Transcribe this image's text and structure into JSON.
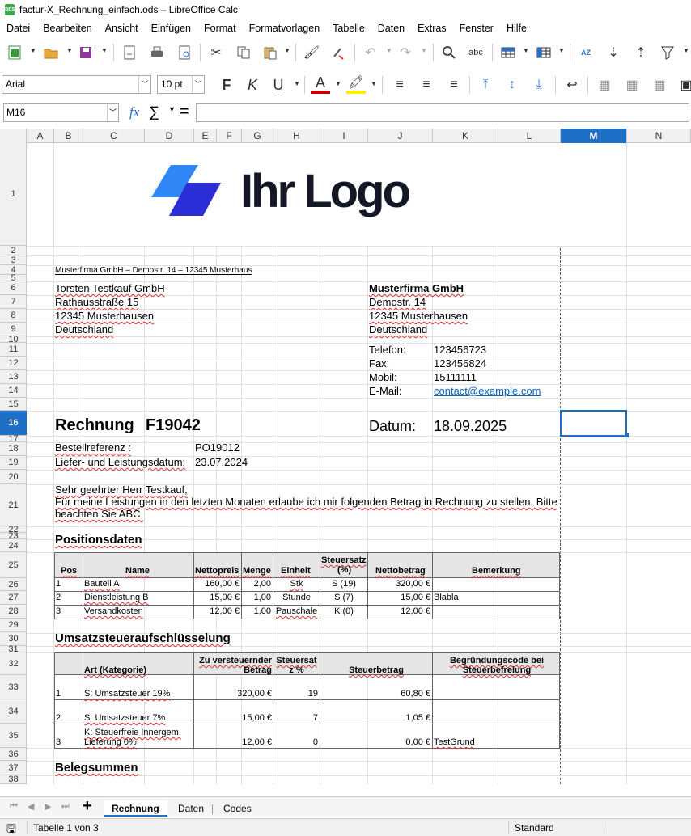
{
  "window": {
    "title": "factur-X_Rechnung_einfach.ods – LibreOffice Calc"
  },
  "menu": [
    "Datei",
    "Bearbeiten",
    "Ansicht",
    "Einfügen",
    "Format",
    "Formatvorlagen",
    "Tabelle",
    "Daten",
    "Extras",
    "Fenster",
    "Hilfe"
  ],
  "format_bar": {
    "font_name": "Arial",
    "font_size": "10 pt"
  },
  "formula_bar": {
    "cell_ref": "M16",
    "value": ""
  },
  "columns": [
    "A",
    "B",
    "C",
    "D",
    "E",
    "F",
    "G",
    "H",
    "I",
    "J",
    "K",
    "L",
    "M",
    "N"
  ],
  "rows": [
    "1",
    "2",
    "3",
    "4",
    "5",
    "6",
    "7",
    "8",
    "9",
    "10",
    "11",
    "12",
    "13",
    "14",
    "15",
    "16",
    "17",
    "18",
    "19",
    "20",
    "21",
    "22",
    "23",
    "24",
    "25",
    "26",
    "27",
    "28",
    "29",
    "30",
    "31",
    "32",
    "33",
    "34",
    "35",
    "36",
    "37",
    "38"
  ],
  "selected": {
    "column": "M",
    "row": "16"
  },
  "logo": {
    "text": "Ihr Logo",
    "colors": [
      "#2f87f5",
      "#2b2ed6"
    ]
  },
  "sender_line": "Musterfirma GmbH – Demostr. 14 – 12345 Musterhaus",
  "recipient": [
    "Torsten Testkauf GmbH",
    "Rathausstraße 15",
    "12345 Musterhausen",
    "Deutschland"
  ],
  "seller": {
    "name": "Musterfirma GmbH",
    "street": "Demostr. 14",
    "city": "12345 Musterhausen",
    "country": "Deutschland"
  },
  "contact": {
    "phone_label": "Telefon:",
    "phone": "123456723",
    "fax_label": "Fax:",
    "fax": "123456824",
    "mobile_label": "Mobil:",
    "mobile": "15111111",
    "email_label": "E-Mail:",
    "email": "contact@example.com"
  },
  "invoice": {
    "title": "Rechnung",
    "number": "F19042",
    "date_label": "Datum:",
    "date": "18.09.2025"
  },
  "order": {
    "ref_label": "Bestellreferenz :",
    "ref": "PO19012",
    "delivery_label": "Liefer- und Leistungsdatum:",
    "delivery": "23.07.2024"
  },
  "letter": {
    "line1": "Sehr geehrter Herr Testkauf,",
    "line2": "Für meine Leistungen in den letzten Monaten erlaube ich mir folgenden Betrag in Rechnung zu stellen. Bitte",
    "line3": "beachten Sie ABC."
  },
  "positions": {
    "heading": "Positionsdaten",
    "headers": {
      "pos": "Pos",
      "name": "Name",
      "net": "Nettopreis",
      "qty": "Menge",
      "unit": "Einheit",
      "tax_l1": "Steuersatz",
      "tax_l2": "(%)",
      "amount": "Nettobetrag",
      "note": "Bemerkung"
    },
    "rows": [
      {
        "pos": "1",
        "name": "Bauteil A",
        "net": "160,00 €",
        "qty": "2,00",
        "unit": "Stk",
        "tax": "S (19)",
        "amount": "320,00 €",
        "note": ""
      },
      {
        "pos": "2",
        "name": "Dienstleistung B",
        "net": "15,00 €",
        "qty": "1,00",
        "unit": "Stunde",
        "tax": "S (7)",
        "amount": "15,00 €",
        "note": "Blabla"
      },
      {
        "pos": "3",
        "name": "Versandkosten",
        "net": "12,00 €",
        "qty": "1,00",
        "unit": "Pauschale",
        "tax": "K (0)",
        "amount": "12,00 €",
        "note": ""
      }
    ]
  },
  "vat": {
    "heading": "Umsatzsteueraufschlüsselung",
    "headers": {
      "cat": "Art (Kategorie)",
      "base_l1": "Zu versteuernder",
      "base_l2": "Betrag",
      "rate_l1": "Steuersat",
      "rate_l2": "z %",
      "tax": "Steuerbetrag",
      "reason_l1": "Begründungscode bei",
      "reason_l2": "Steuerbefreiung"
    },
    "rows": [
      {
        "pos": "1",
        "cat": "S: Umsatzsteuer 19%",
        "cat2": "",
        "base": "320,00 €",
        "rate": "19",
        "tax": "60,80 €",
        "reason": ""
      },
      {
        "pos": "2",
        "cat": "S: Umsatzsteuer 7%",
        "cat2": "",
        "base": "15,00 €",
        "rate": "7",
        "tax": "1,05 €",
        "reason": ""
      },
      {
        "pos": "3",
        "cat": "K: Steuerfreie Innergem.",
        "cat2": "Lieferung 0%",
        "base": "12,00 €",
        "rate": "0",
        "tax": "0,00 €",
        "reason": "TestGrund"
      }
    ]
  },
  "totals": {
    "heading": "Belegsummen"
  },
  "sheets": {
    "active": "Rechnung",
    "tabs": [
      "Rechnung",
      "Daten",
      "Codes"
    ]
  },
  "status": {
    "sheet": "Tabelle 1 von 3",
    "style": "Standard"
  }
}
